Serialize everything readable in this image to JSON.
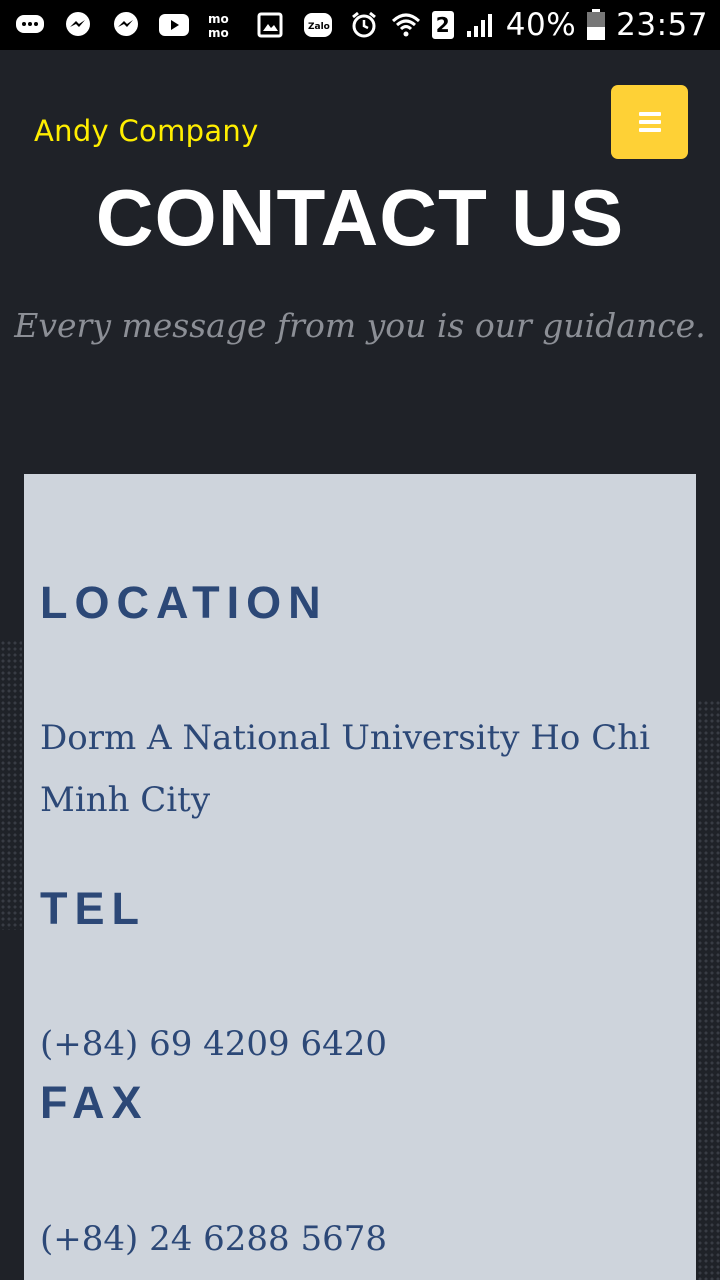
{
  "status_bar": {
    "battery_percent": "40%",
    "time": "23:57",
    "sim_slot": "2",
    "left_icons": [
      "messages-icon",
      "messenger-icon",
      "messenger-icon",
      "youtube-icon",
      "momo-icon",
      "gallery-icon",
      "zalo-icon"
    ],
    "right_icons": [
      "alarm-icon",
      "wifi-icon",
      "sim-icon",
      "signal-icon",
      "battery-icon"
    ]
  },
  "header": {
    "brand": "Andy Company",
    "menu_icon": "hamburger-icon",
    "title": "CONTACT US",
    "subtitle": "Every message from you is our guidance."
  },
  "contact": {
    "location_heading": "LOCATION",
    "location_text": "Dorm A National University Ho Chi Minh City",
    "tel_heading": "TEL",
    "tel_text": "(+84) 69 4209 6420",
    "fax_heading": "FAX",
    "fax_text": "(+84) 24 6288 5678"
  },
  "colors": {
    "background": "#1f2228",
    "brand": "#ffee00",
    "accent": "#fed136",
    "card": "#ced4dc",
    "card_text": "#2c4877"
  }
}
